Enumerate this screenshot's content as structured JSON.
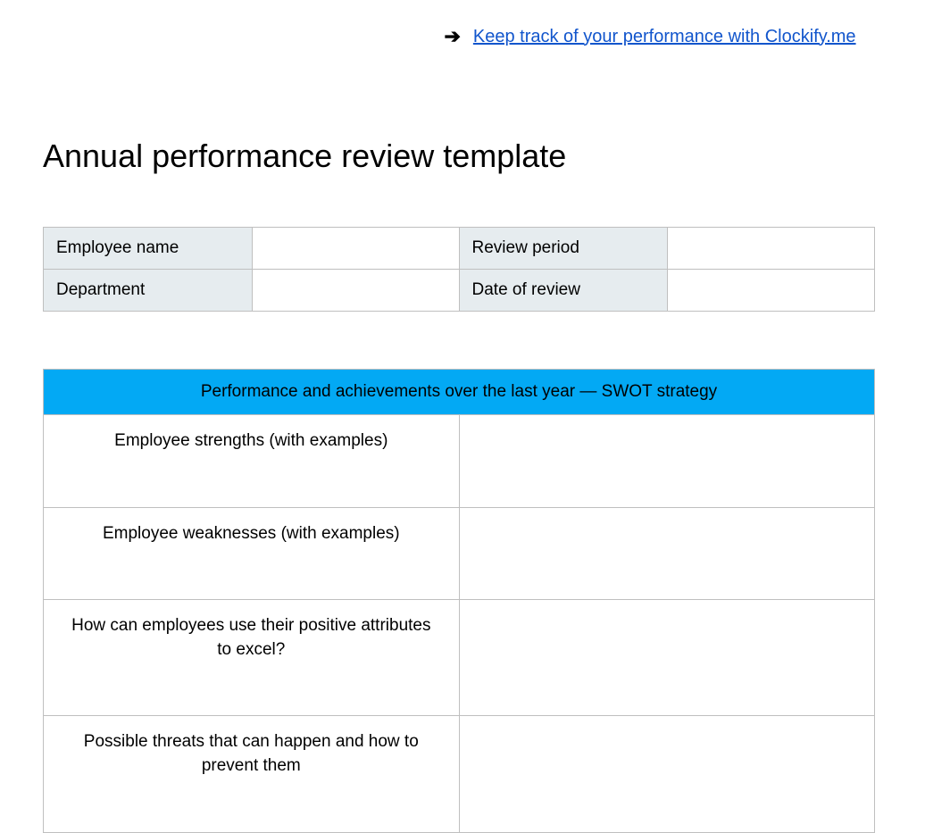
{
  "header": {
    "link_text": "Keep track of your performance with Clockify.me"
  },
  "title": "Annual performance review template",
  "info": {
    "employee_name_label": "Employee name",
    "employee_name_value": "",
    "review_period_label": "Review period",
    "review_period_value": "",
    "department_label": "Department",
    "department_value": "",
    "date_of_review_label": "Date of review",
    "date_of_review_value": ""
  },
  "swot": {
    "section_title": "Performance and achievements over the last year — SWOT strategy",
    "rows": [
      {
        "question": "Employee strengths (with examples)",
        "answer": ""
      },
      {
        "question": "Employee weaknesses (with examples)",
        "answer": ""
      },
      {
        "question": "How can employees use their positive attributes to excel?",
        "answer": ""
      },
      {
        "question": "Possible threats that can happen and how to prevent them",
        "answer": ""
      }
    ]
  }
}
